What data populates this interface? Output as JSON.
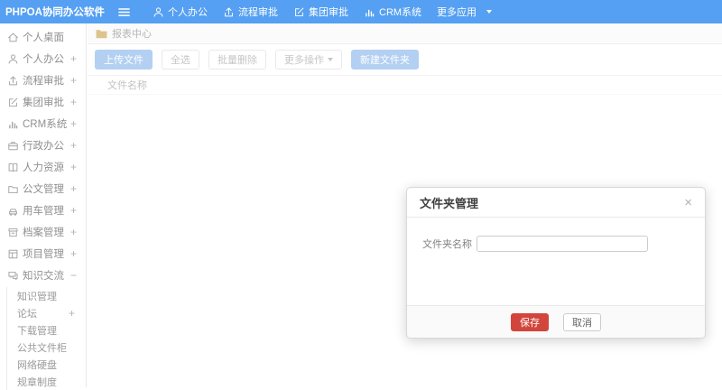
{
  "colors": {
    "header_blue": "#55a0f2",
    "primary_button_faded": "#b3d0f2",
    "save_red": "#d2453c",
    "folder_yellow": "#dcc48f"
  },
  "header": {
    "logo": "PHPOA协同办公软件",
    "nav": [
      {
        "id": "personal-office",
        "label": "个人办公",
        "icon": "user"
      },
      {
        "id": "workflow-approval",
        "label": "流程审批",
        "icon": "flow"
      },
      {
        "id": "group-approval",
        "label": "集团审批",
        "icon": "edit"
      },
      {
        "id": "crm-system",
        "label": "CRM系统",
        "icon": "chart"
      },
      {
        "id": "more-apps",
        "label": "更多应用",
        "icon": "",
        "trailing": "caret-down"
      }
    ]
  },
  "sidebar": {
    "items": [
      {
        "id": "personal-desktop",
        "label": "个人桌面",
        "icon": "home",
        "expand": ""
      },
      {
        "id": "personal-office",
        "label": "个人办公",
        "icon": "user",
        "expand": "+"
      },
      {
        "id": "workflow-approval",
        "label": "流程审批",
        "icon": "flow",
        "expand": "+"
      },
      {
        "id": "group-approval",
        "label": "集团审批",
        "icon": "edit",
        "expand": "+"
      },
      {
        "id": "crm-system",
        "label": "CRM系统",
        "icon": "chart",
        "expand": "+"
      },
      {
        "id": "admin-office",
        "label": "行政办公",
        "icon": "briefcase",
        "expand": "+"
      },
      {
        "id": "human-resources",
        "label": "人力资源",
        "icon": "book",
        "expand": "+"
      },
      {
        "id": "document-management",
        "label": "公文管理",
        "icon": "folder",
        "expand": "+"
      },
      {
        "id": "vehicle-management",
        "label": "用车管理",
        "icon": "car",
        "expand": "+"
      },
      {
        "id": "archive-management",
        "label": "档案管理",
        "icon": "archive",
        "expand": "+"
      },
      {
        "id": "project-management",
        "label": "项目管理",
        "icon": "board",
        "expand": "+"
      },
      {
        "id": "knowledge-exchange",
        "label": "知识交流",
        "icon": "chat",
        "expand": "−"
      }
    ],
    "submenu": [
      {
        "id": "knowledge-management",
        "label": "知识管理",
        "expand": ""
      },
      {
        "id": "forum",
        "label": "论坛",
        "expand": "+"
      },
      {
        "id": "download-management",
        "label": "下载管理",
        "expand": ""
      },
      {
        "id": "public-file-cabinet",
        "label": "公共文件柜",
        "expand": ""
      },
      {
        "id": "network-disk",
        "label": "网络硬盘",
        "expand": ""
      },
      {
        "id": "rules-regulations",
        "label": "规章制度",
        "expand": ""
      }
    ]
  },
  "breadcrumb": {
    "label": "报表中心"
  },
  "toolbar": {
    "upload": "上传文件",
    "select_all": "全选",
    "batch_delete": "批量删除",
    "more_ops": "更多操作",
    "new_folder": "新建文件夹"
  },
  "table": {
    "name_header": "文件名称"
  },
  "modal": {
    "title": "文件夹管理",
    "close": "×",
    "field_label": "文件夹名称",
    "field_value": "",
    "save": "保存",
    "cancel": "取消"
  }
}
